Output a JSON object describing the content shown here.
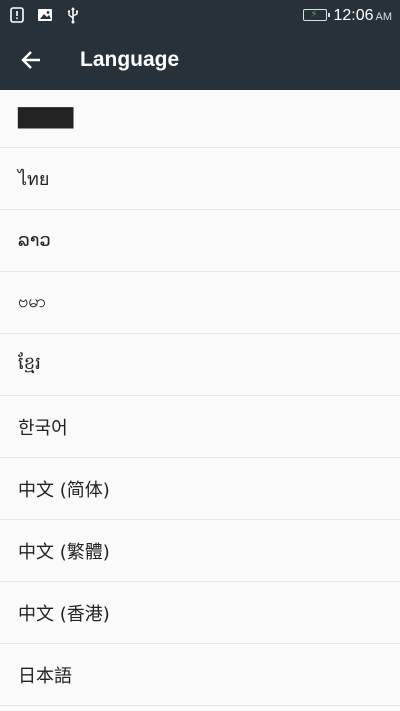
{
  "status_bar": {
    "time": "12:06",
    "ampm": "AM",
    "icons": [
      "alert-icon",
      "image-icon",
      "usb-icon",
      "battery-charging-icon"
    ]
  },
  "app_bar": {
    "back_icon": "arrow-left-icon",
    "title": "Language"
  },
  "languages": [
    "████",
    "ไทย",
    "ລາວ",
    "ဗမာ",
    "ខ្មែរ",
    "한국어",
    "中文 (简体)",
    "中文 (繁體)",
    "中文 (香港)",
    "日本語"
  ],
  "colors": {
    "header_bg": "#26313a",
    "list_bg": "#fafafa",
    "divider": "#e6e6e6",
    "battery_accent": "#4caf50"
  }
}
